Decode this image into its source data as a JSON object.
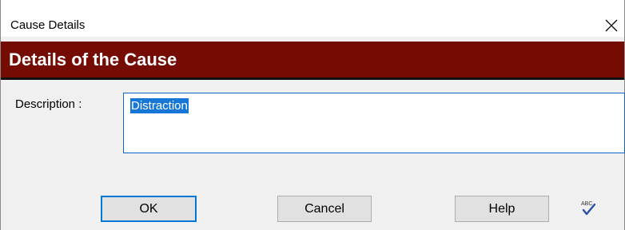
{
  "window": {
    "title": "Cause Details",
    "close_icon": "close-icon"
  },
  "header": {
    "title": "Details of the Cause",
    "background_color": "#740c04"
  },
  "form": {
    "description_label": "Description :",
    "description_value": "Distraction"
  },
  "buttons": {
    "ok_label": "OK",
    "cancel_label": "Cancel",
    "help_label": "Help",
    "spellcheck_icon": "spellcheck-icon",
    "spellcheck_text": "ABC"
  }
}
